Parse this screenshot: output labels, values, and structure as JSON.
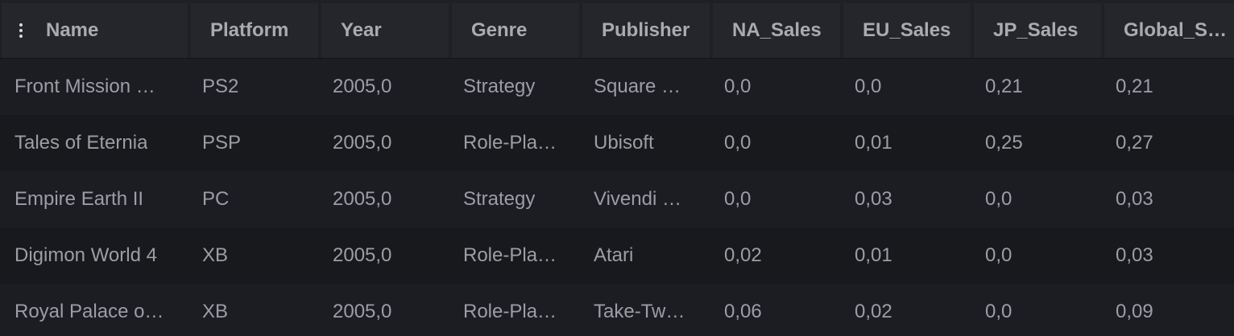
{
  "columns": [
    "Name",
    "Platform",
    "Year",
    "Genre",
    "Publisher",
    "NA_Sales",
    "EU_Sales",
    "JP_Sales",
    "Global_S…"
  ],
  "rows": [
    [
      "Front Mission …",
      "PS2",
      "2005,0",
      "Strategy",
      "Square …",
      "0,0",
      "0,0",
      "0,21",
      "0,21"
    ],
    [
      "Tales of Eternia",
      "PSP",
      "2005,0",
      "Role-Pla…",
      "Ubisoft",
      "0,0",
      "0,01",
      "0,25",
      "0,27"
    ],
    [
      "Empire Earth II",
      "PC",
      "2005,0",
      "Strategy",
      "Vivendi …",
      "0,0",
      "0,03",
      "0,0",
      "0,03"
    ],
    [
      "Digimon World 4",
      "XB",
      "2005,0",
      "Role-Pla…",
      "Atari",
      "0,02",
      "0,01",
      "0,0",
      "0,03"
    ],
    [
      "Royal Palace o…",
      "XB",
      "2005,0",
      "Role-Pla…",
      "Take-Tw…",
      "0,06",
      "0,02",
      "0,0",
      "0,09"
    ]
  ],
  "icons": {
    "column_menu": "vertical-ellipsis-icon"
  }
}
